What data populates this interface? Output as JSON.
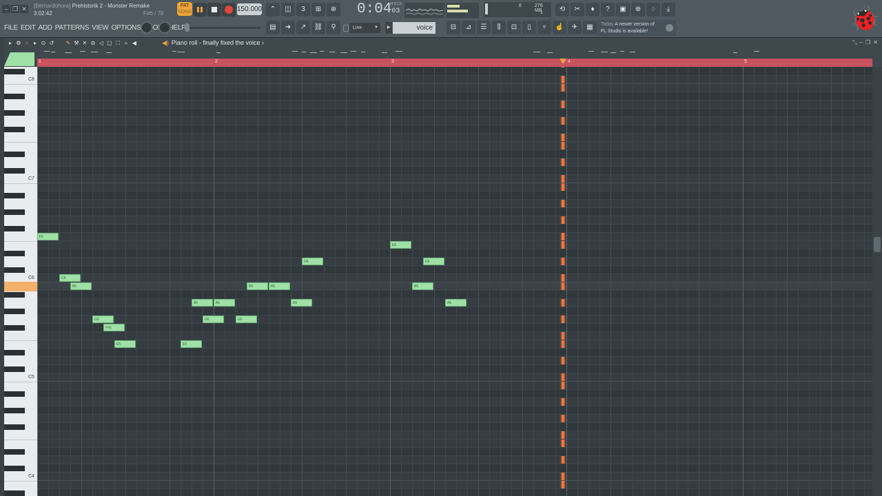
{
  "window": {
    "project_prefix": "[Bernardohora]",
    "project_name": "Prehistorik 2 - Monster Remake",
    "elapsed": "3:02:42",
    "key_info": "F#6 / 78"
  },
  "transport": {
    "pattern_label": "PAT",
    "song_label": "SONG",
    "tempo": "150.000",
    "time_main": "0:04",
    "time_sub": "03",
    "time_unit": "M:S:CS"
  },
  "monitor": {
    "cpu_value": "8",
    "memory": "276 MB",
    "polyphony": "1"
  },
  "menu": [
    "FILE",
    "EDIT",
    "ADD",
    "PATTERNS",
    "VIEW",
    "OPTIONS",
    "TOOLS",
    "HELP"
  ],
  "snap": {
    "value": "Line"
  },
  "channel": {
    "name": "voice"
  },
  "news": {
    "today": "Today",
    "line1": "A newer version of",
    "line2": "FL Studio is available!"
  },
  "piano_roll": {
    "title": "Piano roll - finally fixed the voice",
    "bars": [
      "1",
      "2",
      "3",
      "4",
      "5"
    ],
    "octaves": [
      "C8",
      "C7",
      "C6",
      "C5",
      "C4"
    ],
    "notes": [
      {
        "pitch": "F6",
        "start": 1.0,
        "len": 0.25
      },
      {
        "pitch": "C6",
        "start": 1.5,
        "len": 0.25
      },
      {
        "pitch": "B5",
        "start": 1.75,
        "len": 0.25
      },
      {
        "pitch": "G5",
        "start": 2.25,
        "len": 0.25
      },
      {
        "pitch": "F#5",
        "start": 2.5,
        "len": 0.25
      },
      {
        "pitch": "E5",
        "start": 2.75,
        "len": 0.25
      },
      {
        "pitch": "E5",
        "start": 4.25,
        "len": 0.25
      },
      {
        "pitch": "A5",
        "start": 4.5,
        "len": 0.25
      },
      {
        "pitch": "G5",
        "start": 4.75,
        "len": 0.25
      },
      {
        "pitch": "A5",
        "start": 5.0,
        "len": 0.25
      },
      {
        "pitch": "G5",
        "start": 5.5,
        "len": 0.25
      },
      {
        "pitch": "B5",
        "start": 5.75,
        "len": 0.25
      },
      {
        "pitch": "B5",
        "start": 6.25,
        "len": 0.25
      },
      {
        "pitch": "A5",
        "start": 6.75,
        "len": 0.25
      },
      {
        "pitch": "D6",
        "start": 7.0,
        "len": 0.25
      },
      {
        "pitch": "E6",
        "start": 9.0,
        "len": 0.25
      },
      {
        "pitch": "B5",
        "start": 9.5,
        "len": 0.25
      },
      {
        "pitch": "D6",
        "start": 9.75,
        "len": 0.25
      },
      {
        "pitch": "A5",
        "start": 10.25,
        "len": 0.25
      }
    ],
    "playhead_bar": 3.98,
    "highlight_key": "B5"
  },
  "colors": {
    "note_fill": "#9fe0a7",
    "playhead": "#f0753a",
    "ruler": "#c8525d",
    "accent": "#f0a43a"
  }
}
